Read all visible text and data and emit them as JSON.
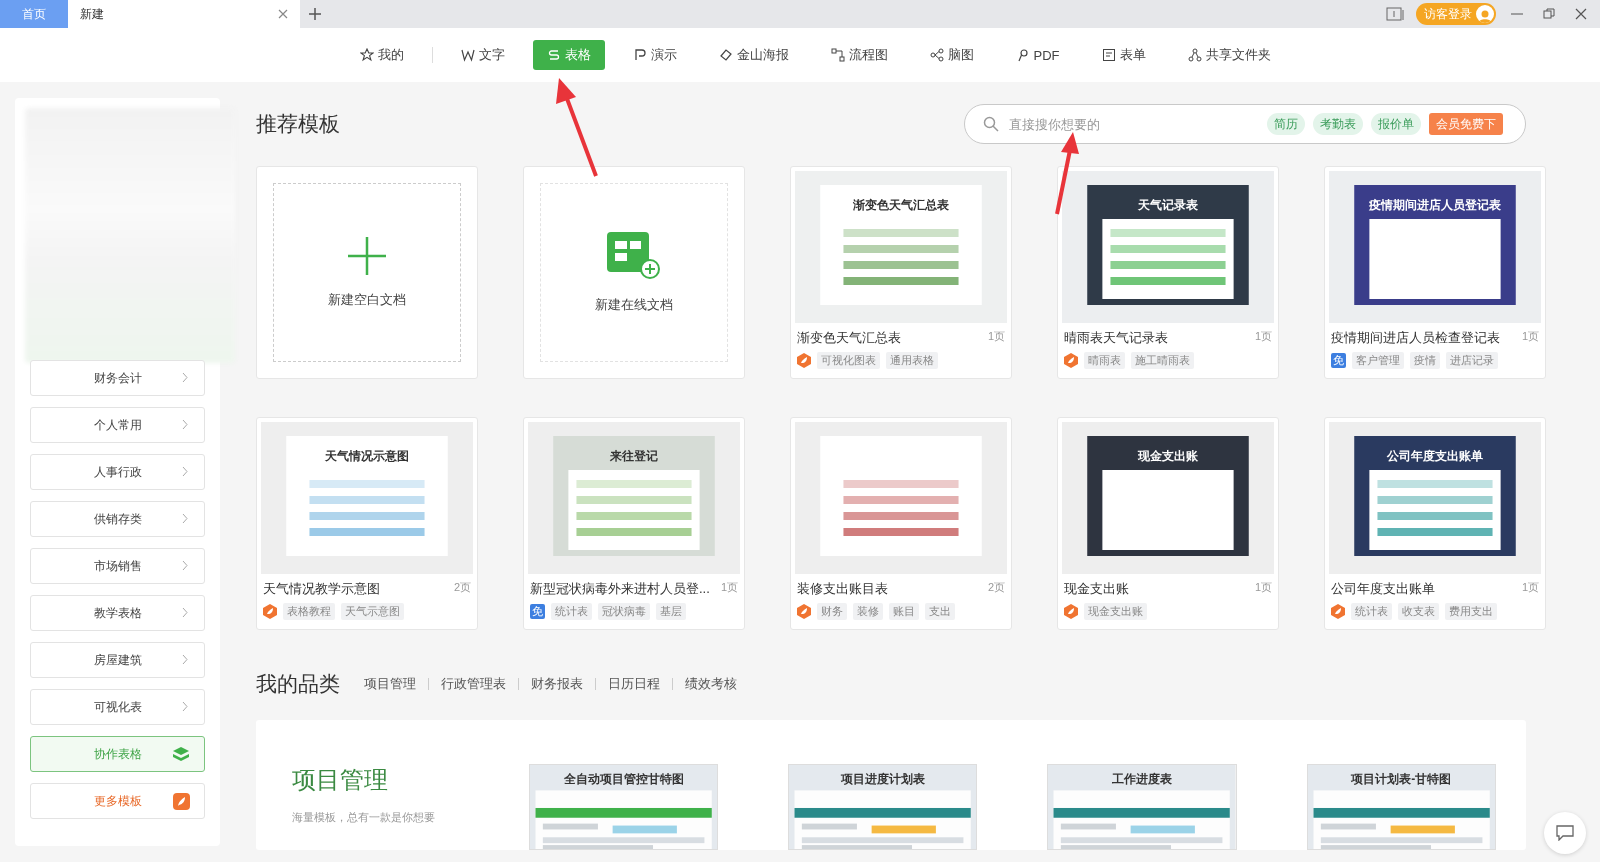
{
  "tabs": [
    {
      "label": "首页",
      "selected": false
    },
    {
      "label": "新建",
      "selected": true
    }
  ],
  "account": {
    "login": "访客登录"
  },
  "nav": [
    {
      "label": "我的",
      "selected": false
    },
    {
      "label": "文字",
      "selected": false
    },
    {
      "label": "表格",
      "selected": true
    },
    {
      "label": "演示",
      "selected": false
    },
    {
      "label": "金山海报",
      "selected": false
    },
    {
      "label": "流程图",
      "selected": false
    },
    {
      "label": "脑图",
      "selected": false
    },
    {
      "label": "PDF",
      "selected": false
    },
    {
      "label": "表单",
      "selected": false
    },
    {
      "label": "共享文件夹",
      "selected": false
    }
  ],
  "sidebar": {
    "items": [
      {
        "label": "财务会计",
        "kind": "plain"
      },
      {
        "label": "个人常用",
        "kind": "plain"
      },
      {
        "label": "人事行政",
        "kind": "plain"
      },
      {
        "label": "供销存类",
        "kind": "plain"
      },
      {
        "label": "市场销售",
        "kind": "plain"
      },
      {
        "label": "教学表格",
        "kind": "plain"
      },
      {
        "label": "房屋建筑",
        "kind": "plain"
      },
      {
        "label": "可视化表",
        "kind": "plain"
      },
      {
        "label": "协作表格",
        "kind": "collab"
      },
      {
        "label": "更多模板",
        "kind": "more"
      }
    ]
  },
  "section_title": "推荐模板",
  "search": {
    "placeholder": "直接搜你想要的",
    "chips": [
      {
        "label": "简历",
        "kind": "tag"
      },
      {
        "label": "考勤表",
        "kind": "tag"
      },
      {
        "label": "报价单",
        "kind": "tag"
      },
      {
        "label": "会员免费下",
        "kind": "promo"
      }
    ]
  },
  "new_cards": [
    {
      "label": "新建空白文档",
      "kind": "blank"
    },
    {
      "label": "新建在线文档",
      "kind": "online"
    }
  ],
  "templates": [
    {
      "preview_title": "渐变色天气汇总表",
      "title": "渐变色天气汇总表",
      "pages": "1页",
      "badge": {
        "kind": "wps"
      },
      "tags": [
        "可视化图表",
        "通用表格"
      ]
    },
    {
      "preview_title": "天气记录表",
      "title": "晴雨表天气记录表",
      "pages": "1页",
      "badge": {
        "kind": "wps"
      },
      "tags": [
        "晴雨表",
        "施工晴雨表"
      ]
    },
    {
      "preview_title": "疫情期间进店人员登记表",
      "title": "疫情期间进店人员检查登记表",
      "pages": "1页",
      "badge": {
        "kind": "free",
        "text": "免"
      },
      "tags": [
        "客户管理",
        "疫情",
        "进店记录"
      ]
    },
    {
      "preview_title": "天气情况示意图",
      "title": "天气情况教学示意图",
      "pages": "2页",
      "badge": {
        "kind": "wps"
      },
      "tags": [
        "表格教程",
        "天气示意图"
      ]
    },
    {
      "preview_title": "来往登记",
      "title": "新型冠状病毒外来进村人员登...",
      "pages": "1页",
      "badge": {
        "kind": "free",
        "text": "免"
      },
      "tags": [
        "统计表",
        "冠状病毒",
        "基层"
      ]
    },
    {
      "title": "装修支出账目表",
      "pages": "2页",
      "badge": {
        "kind": "wps"
      },
      "tags": [
        "财务",
        "装修",
        "账目",
        "支出"
      ]
    },
    {
      "preview_title": "现金支出账",
      "title": "现金支出账",
      "pages": "1页",
      "badge": {
        "kind": "wps"
      },
      "tags": [
        "现金支出账"
      ]
    },
    {
      "preview_title": "公司年度支出账单",
      "title": "公司年度支出账单",
      "pages": "1页",
      "badge": {
        "kind": "wps"
      },
      "tags": [
        "统计表",
        "收支表",
        "费用支出"
      ]
    }
  ],
  "categories": {
    "title": "我的品类",
    "links": [
      "项目管理",
      "行政管理表",
      "财务报表",
      "日历日程",
      "绩效考核"
    ]
  },
  "category_panel": {
    "title": "项目管理",
    "subtitle": "海量模板，总有一款是你想要",
    "previews": [
      {
        "title": "全自动项目管控甘特图"
      },
      {
        "title": "项目进度计划表"
      },
      {
        "title": "工作进度表"
      },
      {
        "title": "项目计划表-甘特图"
      }
    ]
  }
}
